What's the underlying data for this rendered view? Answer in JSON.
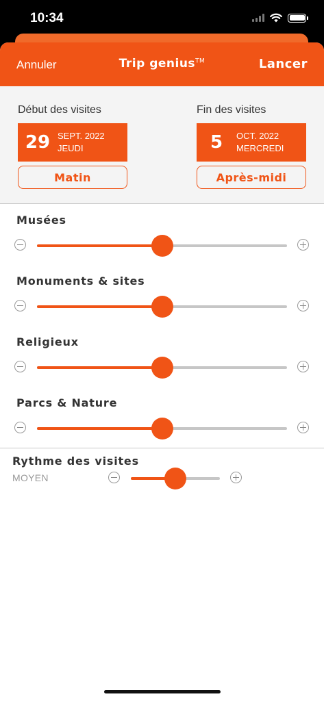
{
  "status_bar": {
    "time": "10:34"
  },
  "nav": {
    "cancel_label": "Annuler",
    "title": "Trip genius",
    "title_mark": "TM",
    "launch_label": "Lancer"
  },
  "dates": {
    "start": {
      "caption": "Début des visites",
      "day": "29",
      "month_year": "SEPT. 2022",
      "weekday": "JEUDI",
      "period": "Matin"
    },
    "end": {
      "caption": "Fin des visites",
      "day": "5",
      "month_year": "OCT. 2022",
      "weekday": "MERCREDI",
      "period": "Après-midi"
    }
  },
  "categories": [
    {
      "label": "Musées",
      "level": 0.5
    },
    {
      "label": "Monuments & sites",
      "level": 0.5
    },
    {
      "label": "Religieux",
      "level": 0.5
    },
    {
      "label": "Parcs & Nature",
      "level": 0.5
    }
  ],
  "rhythm": {
    "title": "Rythme des visites",
    "value": "MOYEN",
    "level": 0.5
  },
  "colors": {
    "accent": "#f05416",
    "track": "#c6c6c6",
    "panel": "#f4f4f4"
  }
}
